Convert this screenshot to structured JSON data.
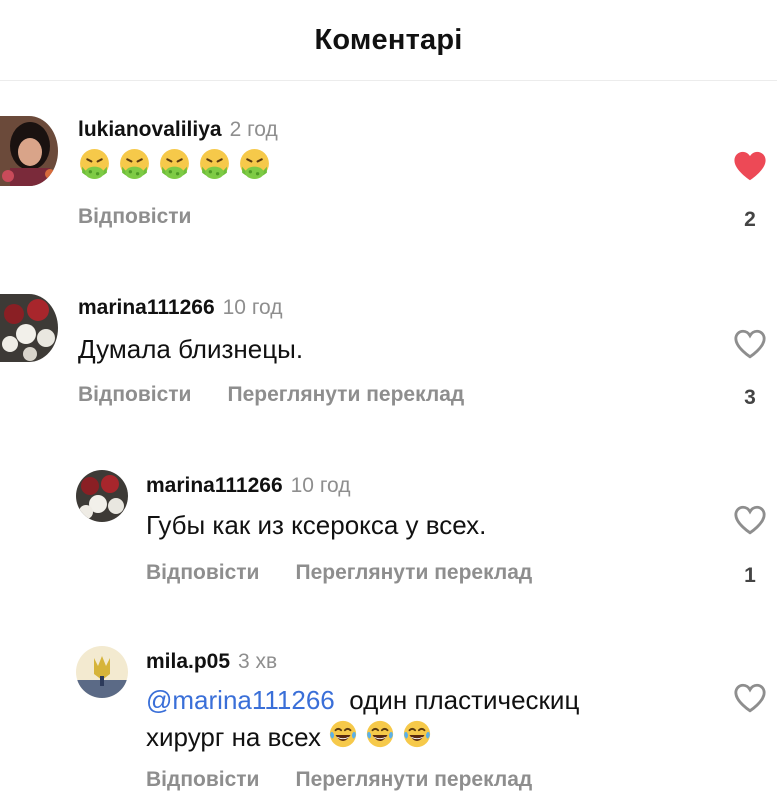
{
  "header": {
    "title": "Коментарі"
  },
  "colors": {
    "like_active": "#ed4956",
    "mention": "#3a6fd8",
    "muted": "#8e8e8e"
  },
  "comments": [
    {
      "username": "lukianovaliliya",
      "time": "2 год",
      "emoji_name": "nauseated-face-emoji",
      "emoji_count": 5,
      "reply_label": "Відповісти",
      "liked": true,
      "likes": "2"
    },
    {
      "username": "marina111266",
      "time": "10 год",
      "text": "Думала близнецы.",
      "reply_label": "Відповісти",
      "translate_label": "Переглянути переклад",
      "liked": false,
      "likes": "3"
    },
    {
      "username": "marina111266",
      "time": "10 год",
      "text": "Губы как из ксерокса у всех.",
      "reply_label": "Відповісти",
      "translate_label": "Переглянути переклад",
      "liked": false,
      "likes": "1"
    },
    {
      "username": "mila.p05",
      "time": "3 хв",
      "mention": "@marina111266",
      "text_line1": "один пластическиц",
      "text_line2": "хирург на всех",
      "emoji_name": "tears-of-joy-emoji",
      "emoji_count": 3,
      "reply_label": "Відповісти",
      "translate_label": "Переглянути переклад",
      "liked": false
    }
  ]
}
